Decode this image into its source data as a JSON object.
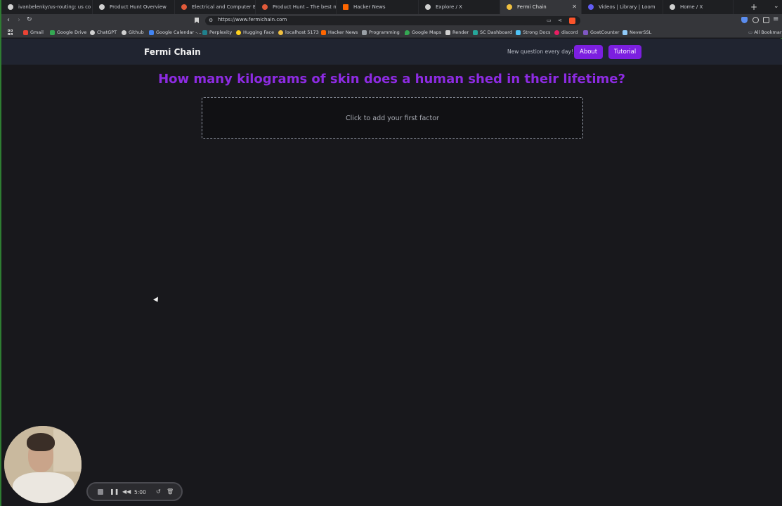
{
  "browser": {
    "tabs": [
      {
        "label": "ivanbelenky/us-routing: us co",
        "icon_color": "#d0d0d0"
      },
      {
        "label": "Product Hunt Overview",
        "icon_color": "#d0d0d0"
      },
      {
        "label": "Electrical and Computer Engin",
        "icon_color": "#e05a3a"
      },
      {
        "label": "Product Hunt – The best new",
        "icon_color": "#e05a3a"
      },
      {
        "label": "Hacker News",
        "icon_color": "#ff6600"
      },
      {
        "label": "Explore / X",
        "icon_color": "#d0d0d0"
      },
      {
        "label": "Fermi Chain",
        "icon_color": "#f0c040"
      },
      {
        "label": "Videos | Library | Loom",
        "icon_color": "#625df5"
      },
      {
        "label": "Home / X",
        "icon_color": "#d0d0d0"
      }
    ],
    "new_tab_symbol": "+",
    "url": "https://www.fermichain.com",
    "bookmarks": [
      {
        "label": "Gmail",
        "icon_color": "#ea4335"
      },
      {
        "label": "Google Drive",
        "icon_color": "#34a853"
      },
      {
        "label": "ChatGPT",
        "icon_color": "#d0d0d0"
      },
      {
        "label": "Github",
        "icon_color": "#d0d0d0"
      },
      {
        "label": "Google Calendar -...",
        "icon_color": "#4285f4"
      },
      {
        "label": "Perplexity",
        "icon_color": "#20808d"
      },
      {
        "label": "Hugging Face",
        "icon_color": "#ffd21e"
      },
      {
        "label": "localhost 5173",
        "icon_color": "#f0c040"
      },
      {
        "label": "Hacker News",
        "icon_color": "#ff6600"
      },
      {
        "label": "Programming",
        "icon_color": "#9aa0a6"
      },
      {
        "label": "Google Maps",
        "icon_color": "#34a853"
      },
      {
        "label": "Render",
        "icon_color": "#d0d0d0"
      },
      {
        "label": "SC Dashboard",
        "icon_color": "#26a69a"
      },
      {
        "label": "Strong Docs",
        "icon_color": "#4fc3f7"
      },
      {
        "label": "discord",
        "icon_color": "#e91e63"
      },
      {
        "label": "GoatCounter",
        "icon_color": "#7e57c2"
      },
      {
        "label": "NeverSSL",
        "icon_color": "#90caf9"
      }
    ],
    "all_bookmarks_label": "All Bookmarks"
  },
  "site": {
    "title": "Fermi Chain",
    "tagline": "New question every day!",
    "about_label": "About",
    "tutorial_label": "Tutorial",
    "question": "How many kilograms of skin does a human shed in their lifetime?",
    "factor_placeholder": "Click to add your first factor",
    "accent_color": "#7c1fe0"
  },
  "loom": {
    "timer": "5:00"
  }
}
